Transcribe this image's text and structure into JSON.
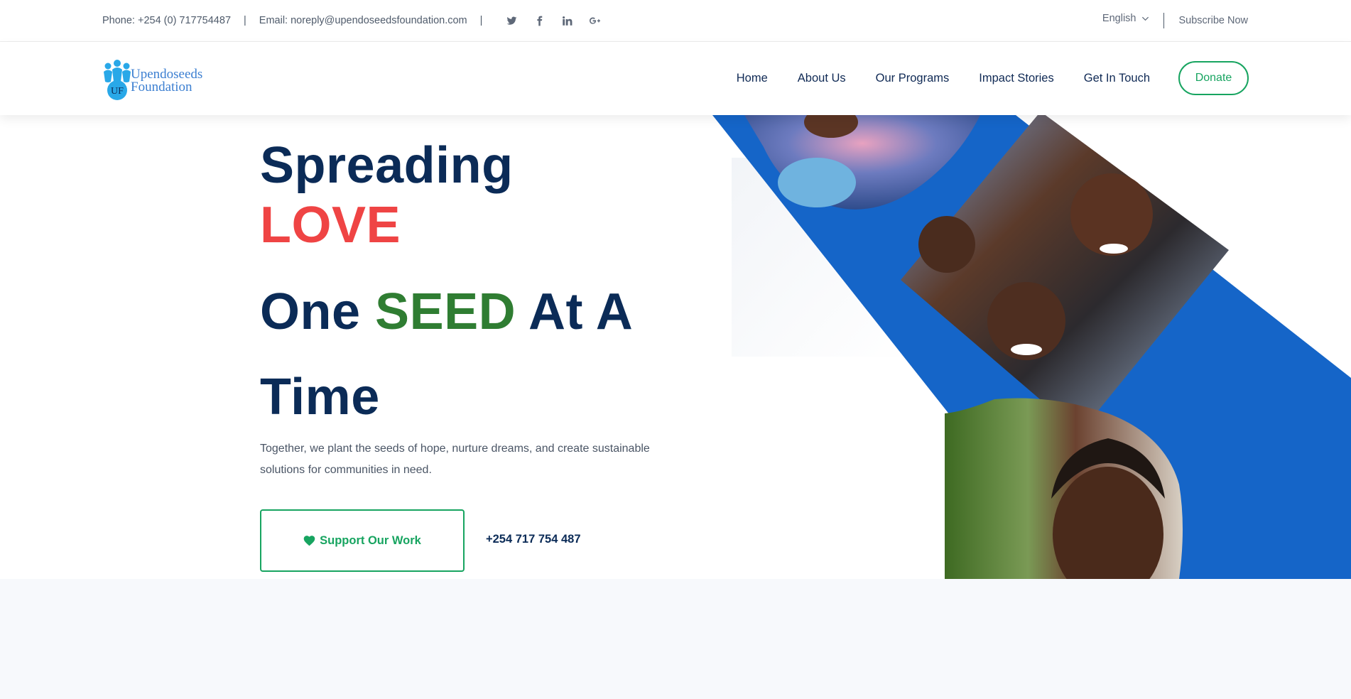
{
  "topbar": {
    "phone": "Phone: +254 (0) 717754487",
    "separator": "|",
    "email": "Email: noreply@upendoseedsfoundation.com",
    "social_icons": [
      "twitter-icon",
      "facebook-icon",
      "linkedin-icon",
      "google-plus-icon"
    ],
    "language": "English",
    "subscribe": "Subscribe Now"
  },
  "header": {
    "logo": {
      "initials": "UF",
      "line1": "Upendoseeds",
      "line2": "Foundation"
    },
    "nav": [
      "Home",
      "About Us",
      "Our Programs",
      "Impact Stories",
      "Get In Touch"
    ],
    "donate": "Donate"
  },
  "hero": {
    "line1": "Spreading",
    "line2": "LOVE",
    "line3_a": "One",
    "line3_b": "SEED",
    "line3_c": "At A",
    "line4": "Time",
    "description": "Together, we plant the seeds of hope, nurture dreams, and create sustainable solutions for communities in need.",
    "cta": "Support Our Work",
    "cta_icon": "heart-icon",
    "phone": "+254 717 754 487"
  },
  "colors": {
    "navy": "#0b2b57",
    "red": "#ef4444",
    "green_text": "#2f7d32",
    "accent_green": "#17a460",
    "blue_band": "#1565c8",
    "logo_blue": "#3c7fd1"
  }
}
